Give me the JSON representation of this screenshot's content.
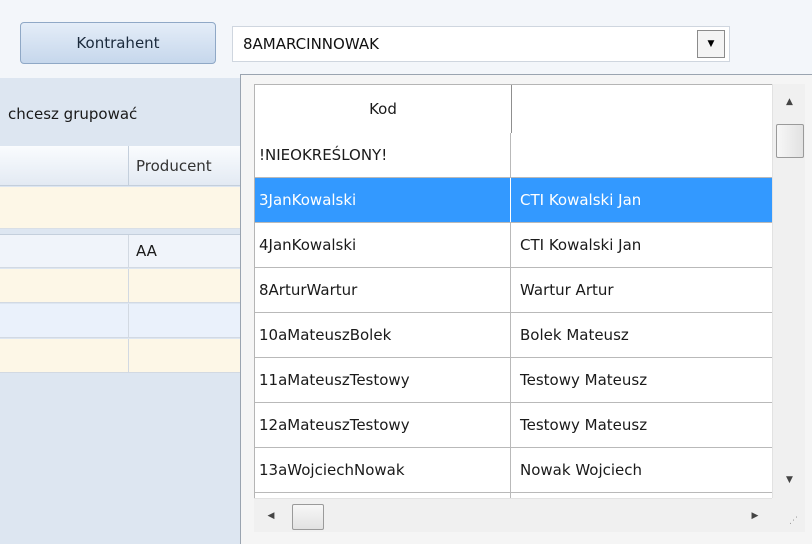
{
  "toolbar": {
    "kontrahent_label": "Kontrahent",
    "combo_value": "8AMARCINNOWAK",
    "combo_arrow_icon": "chevron-down-icon"
  },
  "background_grid": {
    "group_hint": "chcesz grupować",
    "column_header": "Producent",
    "rows": [
      "AA",
      "",
      "",
      ""
    ]
  },
  "dropdown": {
    "columns": [
      "Kod",
      ""
    ],
    "rows": [
      {
        "kod": "!NIEOKREŚLONY!",
        "nazwa": ""
      },
      {
        "kod": "3JanKowalski",
        "nazwa": "CTI Kowalski Jan"
      },
      {
        "kod": "4JanKowalski",
        "nazwa": "CTI Kowalski Jan"
      },
      {
        "kod": "8ArturWartur",
        "nazwa": "Wartur Artur"
      },
      {
        "kod": "10aMateuszBolek",
        "nazwa": "Bolek Mateusz"
      },
      {
        "kod": "11aMateuszTestowy",
        "nazwa": "Testowy Mateusz"
      },
      {
        "kod": "12aMateuszTestowy",
        "nazwa": "Testowy Mateusz"
      },
      {
        "kod": "13aWojciechNowak",
        "nazwa": "Nowak Wojciech"
      },
      {
        "kod": "",
        "nazwa": ""
      }
    ],
    "selected_index": 1
  },
  "colors": {
    "selection": "#3399ff",
    "button_gradient_top": "#e4edf8",
    "button_gradient_bottom": "#c6d7ec",
    "row_alt": "#fdf7e7"
  }
}
